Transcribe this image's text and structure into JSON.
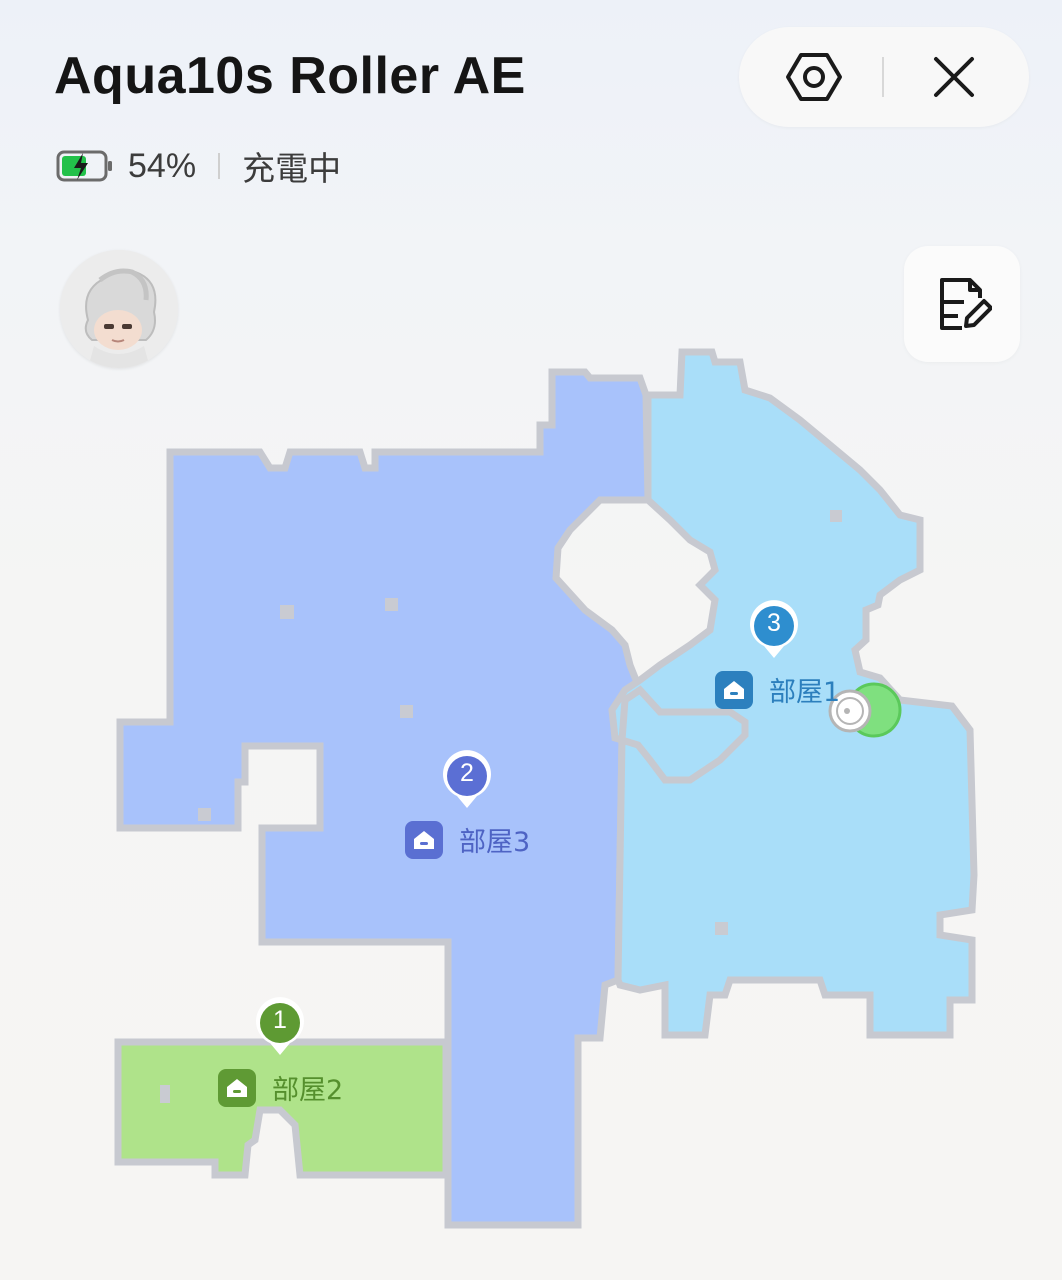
{
  "header": {
    "title": "Aqua10s Roller AE",
    "battery_percent": "54%",
    "battery_level": 0.54,
    "charging_status": "充電中"
  },
  "toolbar": {
    "settings_icon": "hexagon-settings-icon",
    "close_icon": "close-icon",
    "edit_icon": "map-edit-icon"
  },
  "rooms": [
    {
      "name": "部屋1",
      "order": "3",
      "color": "#a9def9",
      "label_color": "#2c80be"
    },
    {
      "name": "部屋3",
      "order": "2",
      "color": "#a8c2fb",
      "label_color": "#5a6fd2"
    },
    {
      "name": "部屋2",
      "order": "1",
      "color": "#afe38a",
      "label_color": "#5f9a34"
    }
  ],
  "colors": {
    "wall": "#c7c9d0",
    "dock": "#7fe07f",
    "battery_green": "#22c14a"
  }
}
